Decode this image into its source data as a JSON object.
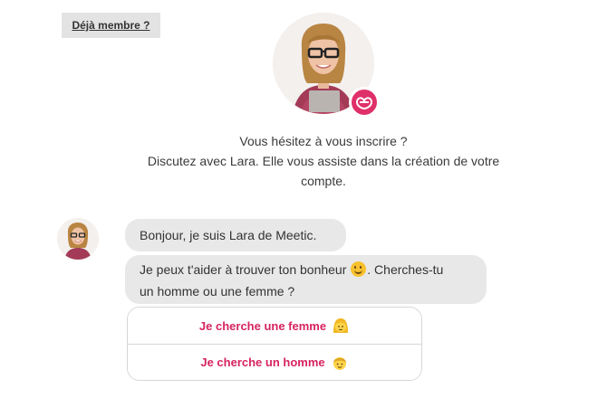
{
  "header": {
    "member_link": "Déjà membre ?"
  },
  "intro": {
    "line1": "Vous hésitez à vous inscrire ?",
    "line2": "Discutez avec Lara. Elle vous assiste dans la création de votre",
    "line3": "compte."
  },
  "chat": {
    "msg1": "Bonjour, je suis Lara de Meetic.",
    "msg2_part1": "Je peux t'aider à trouver ton bonheur",
    "msg2_part2": ". Cherches-tu",
    "msg2_line2": "un homme ou une femme ?"
  },
  "choices": {
    "woman": "Je cherche une femme",
    "man": "Je cherche un homme"
  },
  "colors": {
    "brand": "#e0306a",
    "choice_text": "#d6245f",
    "bubble_bg": "#e8e8e8"
  },
  "icons": {
    "badge": "meetic-logo-icon",
    "smile": "smiling-face-icon",
    "woman": "woman-emoji-icon",
    "man": "man-emoji-icon"
  }
}
